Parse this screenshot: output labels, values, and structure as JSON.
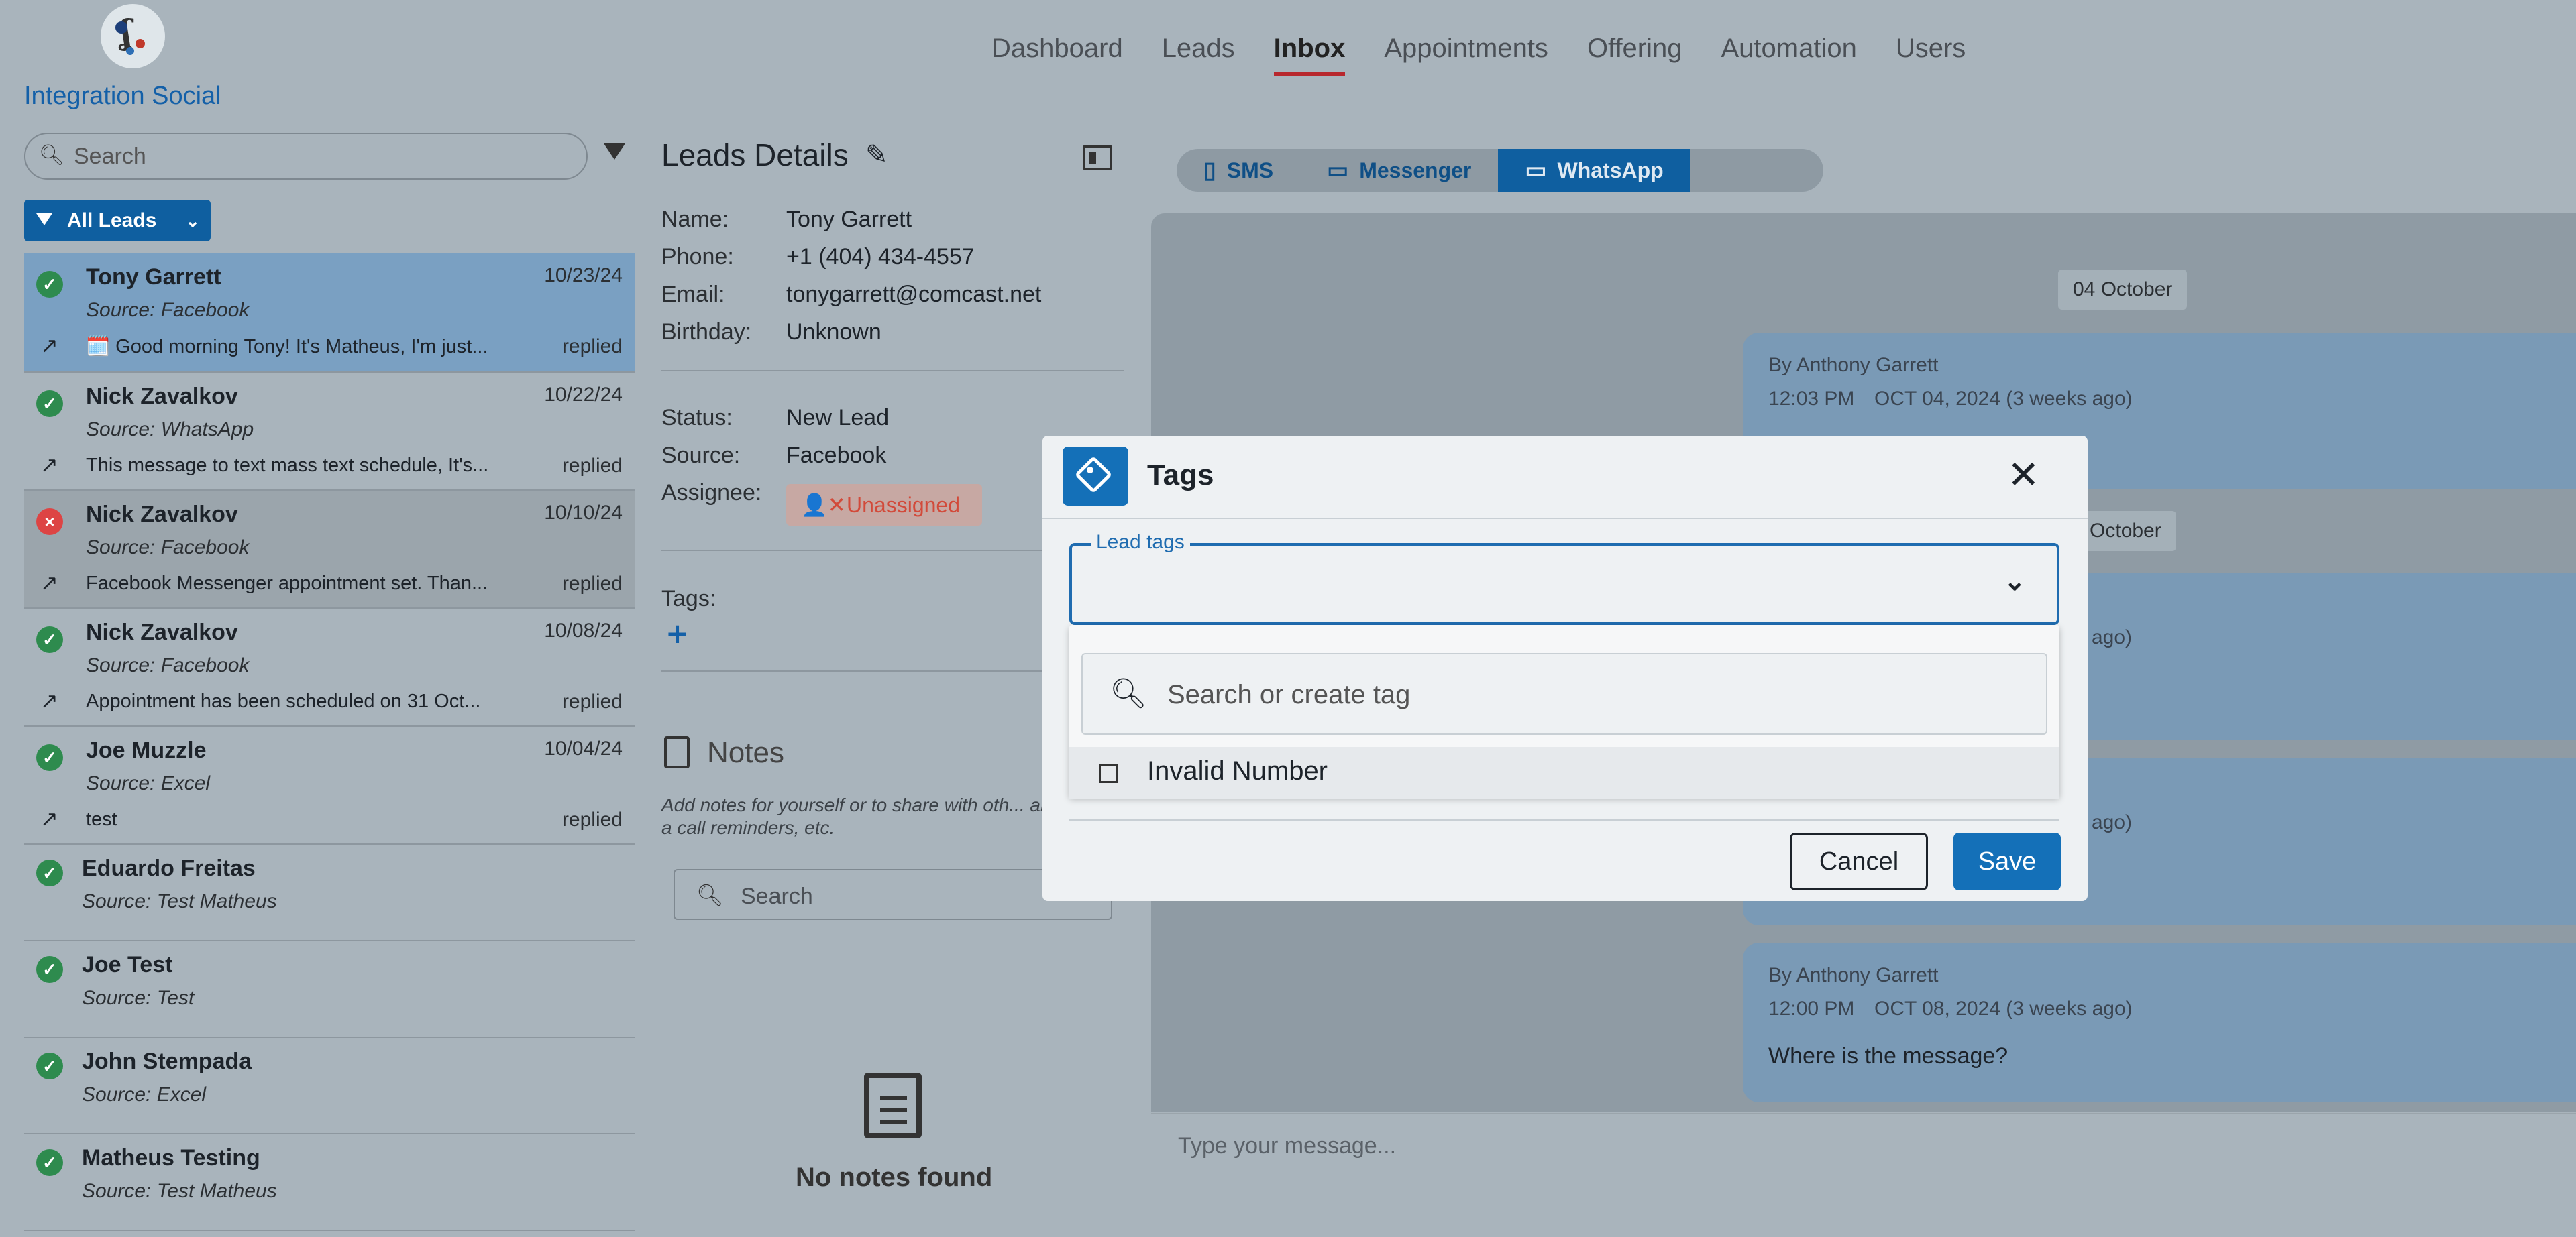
{
  "brand": {
    "name": "Integration Social"
  },
  "nav": {
    "items": [
      "Dashboard",
      "Leads",
      "Inbox",
      "Appointments",
      "Offering",
      "Automation",
      "Users"
    ],
    "active": "Inbox"
  },
  "left": {
    "search_placeholder": "Search",
    "filter_button": "All Leads",
    "leads": [
      {
        "name": "Tony Garrett",
        "source": "Source: Facebook",
        "date": "10/23/24",
        "message": "🗓️ Good morning Tony! It's Matheus, I'm just...",
        "status": "replied",
        "ok": true
      },
      {
        "name": "Nick Zavalkov",
        "source": "Source: WhatsApp",
        "date": "10/22/24",
        "message": "This message to text mass text schedule, It's...",
        "status": "replied",
        "ok": true
      },
      {
        "name": "Nick Zavalkov",
        "source": "Source: Facebook",
        "date": "10/10/24",
        "message": "Facebook Messenger appointment set. Than...",
        "status": "replied",
        "ok": false
      },
      {
        "name": "Nick Zavalkov",
        "source": "Source: Facebook",
        "date": "10/08/24",
        "message": "Appointment has been scheduled on 31 Oct...",
        "status": "replied",
        "ok": true
      },
      {
        "name": "Joe Muzzle",
        "source": "Source: Excel",
        "date": "10/04/24",
        "message": "test",
        "status": "replied",
        "ok": true
      },
      {
        "name": "Eduardo Freitas",
        "source": "Source: Test Matheus",
        "ok": true
      },
      {
        "name": "Joe Test",
        "source": "Source: Test",
        "ok": true
      },
      {
        "name": "John Stempada",
        "source": "Source: Excel",
        "ok": true
      },
      {
        "name": "Matheus Testing",
        "source": "Source: Test Matheus",
        "ok": true
      }
    ]
  },
  "details": {
    "title": "Leads Details",
    "name_label": "Name:",
    "name": "Tony Garrett",
    "phone_label": "Phone:",
    "phone": "+1 (404) 434-4557",
    "email_label": "Email:",
    "email": "tonygarrett@comcast.net",
    "birthday_label": "Birthday:",
    "birthday": "Unknown",
    "status_label": "Status:",
    "status": "New Lead",
    "source_label": "Source:",
    "source": "Facebook",
    "assignee_label": "Assignee:",
    "assignee": "Unassigned",
    "tags_label": "Tags:",
    "notes_title": "Notes",
    "notes_help": "Add notes for yourself or to share with oth... about a call reminders, etc.",
    "notes_search_placeholder": "Search",
    "no_notes": "No notes found"
  },
  "chat": {
    "channels": [
      {
        "label": "SMS",
        "icon": "phone-icon"
      },
      {
        "label": "Messenger",
        "icon": "chat-icon"
      },
      {
        "label": "WhatsApp",
        "icon": "chat-icon",
        "active": true
      }
    ],
    "date1": "04 October",
    "date2": "8 October",
    "msg1": {
      "by": "By Anthony Garrett",
      "time": "12:03 PM",
      "date": "OCT 04, 2024 (3 weeks ago)"
    },
    "msg2_time_tail": "ago)",
    "msg3_time_tail": "ago)",
    "msg4": {
      "by": "By Anthony Garrett",
      "time": "12:00 PM",
      "date": "OCT 08, 2024 (3 weeks ago)",
      "text": "Where is the message?"
    },
    "composer_placeholder": "Type your message..."
  },
  "modal": {
    "title": "Tags",
    "field_label": "Lead tags",
    "search_placeholder": "Search or create tag",
    "options": [
      "Invalid Number"
    ],
    "cancel": "Cancel",
    "save": "Save"
  },
  "colors": {
    "accent": "#1470b8",
    "nav_active_underline": "#b8272d",
    "status_ok": "#2e8b4e",
    "status_bad": "#d44"
  }
}
